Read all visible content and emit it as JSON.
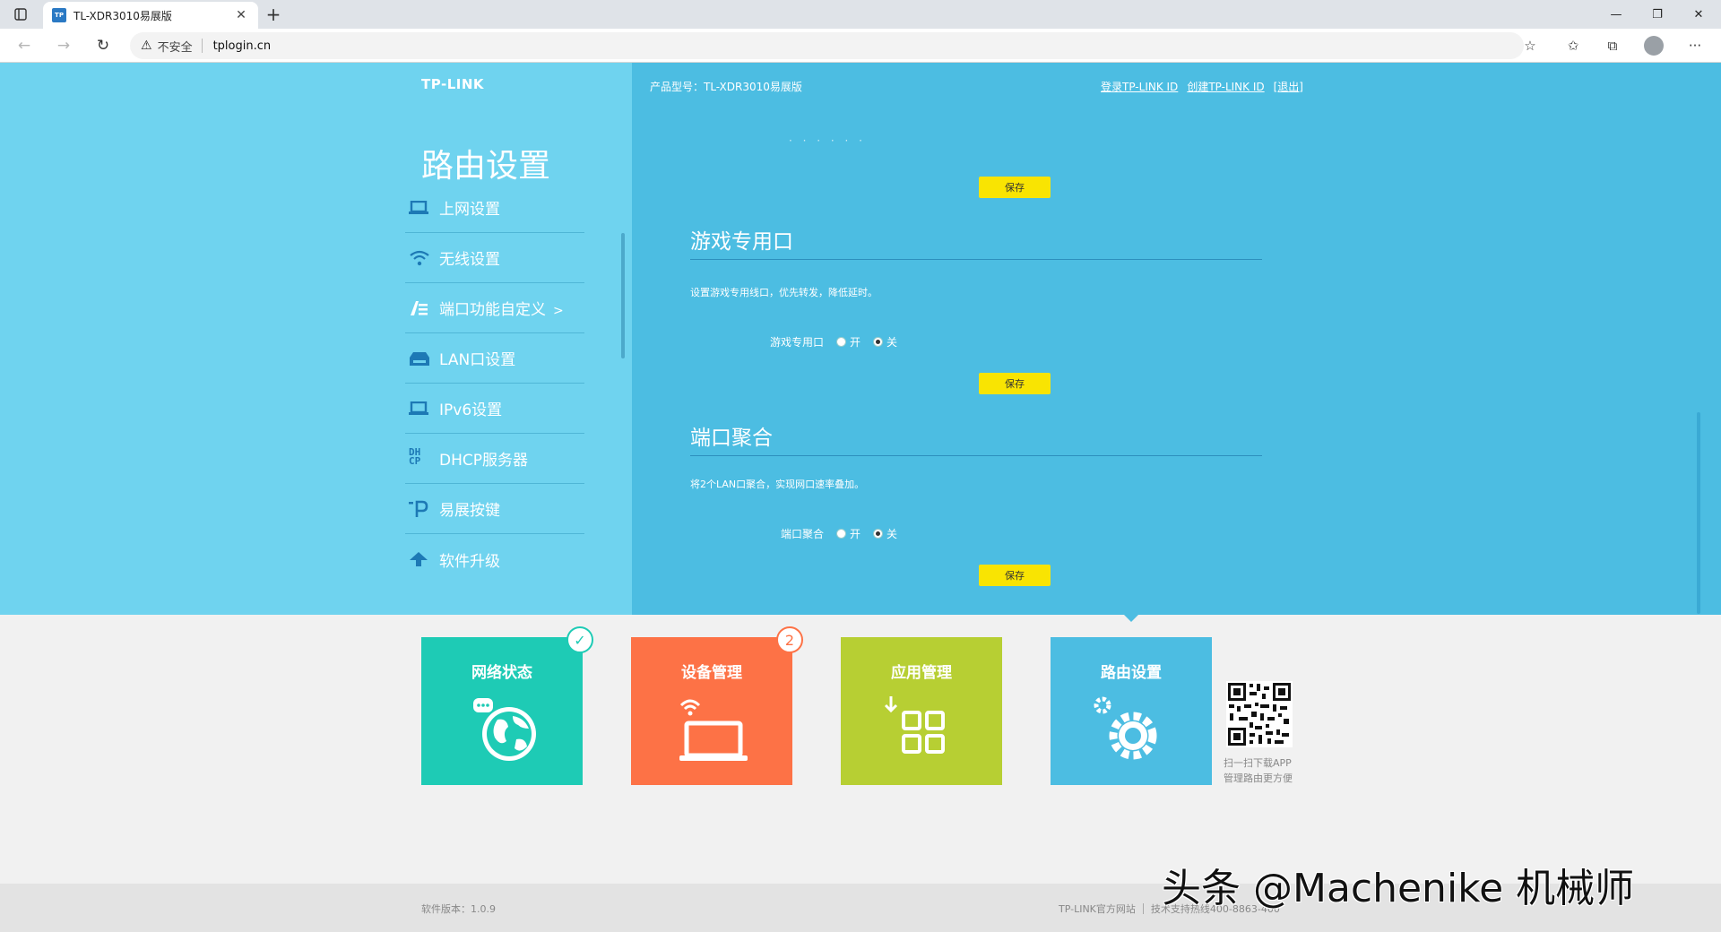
{
  "browser": {
    "tab_title": "TL-XDR3010易展版",
    "favicon_text": "TP",
    "url_warning": "不安全",
    "url": "tplogin.cn"
  },
  "header": {
    "logo": "TP-LINK",
    "model": "产品型号：TL-XDR3010易展版",
    "links": [
      "登录TP-LINK ID",
      "创建TP-LINK ID",
      "[退出]"
    ]
  },
  "sidebar": {
    "title": "路由设置",
    "items": [
      {
        "label": "上网设置",
        "icon": "laptop-icon"
      },
      {
        "label": "无线设置",
        "icon": "wifi-icon"
      },
      {
        "label": "端口功能自定义",
        "icon": "port-custom-icon",
        "active": true,
        "caret": ">"
      },
      {
        "label": "LAN口设置",
        "icon": "lan-icon"
      },
      {
        "label": "IPv6设置",
        "icon": "laptop-icon"
      },
      {
        "label": "DHCP服务器",
        "icon": "dhcp-icon"
      },
      {
        "label": "易展按键",
        "icon": "easy-expand-icon"
      },
      {
        "label": "软件升级",
        "icon": "upload-arrow-icon"
      }
    ]
  },
  "content": {
    "top_save": "保存",
    "game_port": {
      "title": "游戏专用口",
      "desc": "设置游戏专用线口，优先转发，降低延时。",
      "label": "游戏专用口",
      "on": "开",
      "off": "关",
      "selected": "off",
      "save": "保存"
    },
    "link_agg": {
      "title": "端口聚合",
      "desc": "将2个LAN口聚合，实现网口速率叠加。",
      "label": "端口聚合",
      "on": "开",
      "off": "关",
      "selected": "off",
      "save": "保存"
    }
  },
  "tiles": [
    {
      "title": "网络状态",
      "color": "#1ecbb5",
      "badge": "✓"
    },
    {
      "title": "设备管理",
      "color": "#fd7246",
      "badge": "2"
    },
    {
      "title": "应用管理",
      "color": "#b7cf33",
      "badge": ""
    },
    {
      "title": "路由设置",
      "color": "#4cbde2",
      "badge": ""
    }
  ],
  "qr_text": [
    "扫一扫下载APP",
    "管理路由更方便"
  ],
  "footer": {
    "version": "软件版本：1.0.9",
    "official_site": "TP-LINK官方网站",
    "support": "技术支持热线400-8863-400"
  },
  "watermark": "头条 @Machenike 机械师",
  "colors": {
    "left_panel": "#6fd3ef",
    "right_panel": "#4cbde2",
    "save_button": "#f9e402"
  }
}
